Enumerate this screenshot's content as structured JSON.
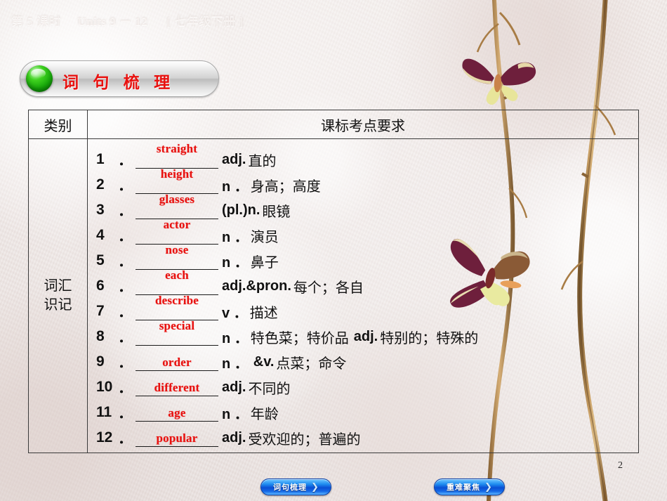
{
  "header": {
    "lesson": "第 5 课时",
    "units": "Units 9 － 12",
    "grade": "[ 七年级下册 ]"
  },
  "section_banner": {
    "title": "词 句 梳 理",
    "ball_icon": "green-ball-icon"
  },
  "table": {
    "columns": [
      "类别",
      "课标考点要求"
    ],
    "category_label_line1": "词汇",
    "category_label_line2": "识记",
    "rows": [
      {
        "num": "1",
        "answer": "straight",
        "pos": "adj.",
        "meaning": "直的"
      },
      {
        "num": "2",
        "answer": "height",
        "pos": "n ．",
        "meaning": "身高；高度"
      },
      {
        "num": "3",
        "answer": "glasses",
        "pos": "(pl.)n.",
        "meaning": "眼镜"
      },
      {
        "num": "4",
        "answer": "actor",
        "pos": "n ．",
        "meaning": "演员"
      },
      {
        "num": "5",
        "answer": "nose",
        "pos": "n ．",
        "meaning": "鼻子"
      },
      {
        "num": "6",
        "answer": "each",
        "pos": "adj.&pron.",
        "meaning": "每个；各自"
      },
      {
        "num": "7",
        "answer": "describe",
        "pos": "v ．",
        "meaning": "描述"
      },
      {
        "num": "8",
        "answer": "special",
        "pos": "n ．",
        "meaning": "特色菜；特价品",
        "pos2": "adj.",
        "meaning2": "特别的；特殊的"
      },
      {
        "num": "9",
        "answer": "order",
        "pos": "n ．",
        "pos2": "&v.",
        "meaning2": "点菜；命令"
      },
      {
        "num": "10",
        "answer": "different",
        "pos": "adj.",
        "meaning": "不同的"
      },
      {
        "num": "11",
        "answer": "age",
        "pos": "n ．",
        "meaning": "年龄"
      },
      {
        "num": "12",
        "answer": "popular",
        "pos": "adj.",
        "meaning": "受欢迎的；普遍的"
      }
    ]
  },
  "footer": {
    "buttons": [
      {
        "label": "词句梳理",
        "chevron": "chevron-right-icon"
      },
      {
        "label": "重难聚焦",
        "chevron": "chevron-right-icon"
      }
    ],
    "page_number": "2"
  },
  "decorations": {
    "butterfly_top": "butterfly-icon",
    "butterfly_middle": "butterfly-icon",
    "branch_left": "branch-icon",
    "branch_right": "branch-icon"
  },
  "colors": {
    "answer_red": "#e8110f",
    "banner_red": "#e8110f",
    "paper": "#ece5e3",
    "button_blue": "#0a4fd4",
    "ball_green": "#17a80a"
  }
}
